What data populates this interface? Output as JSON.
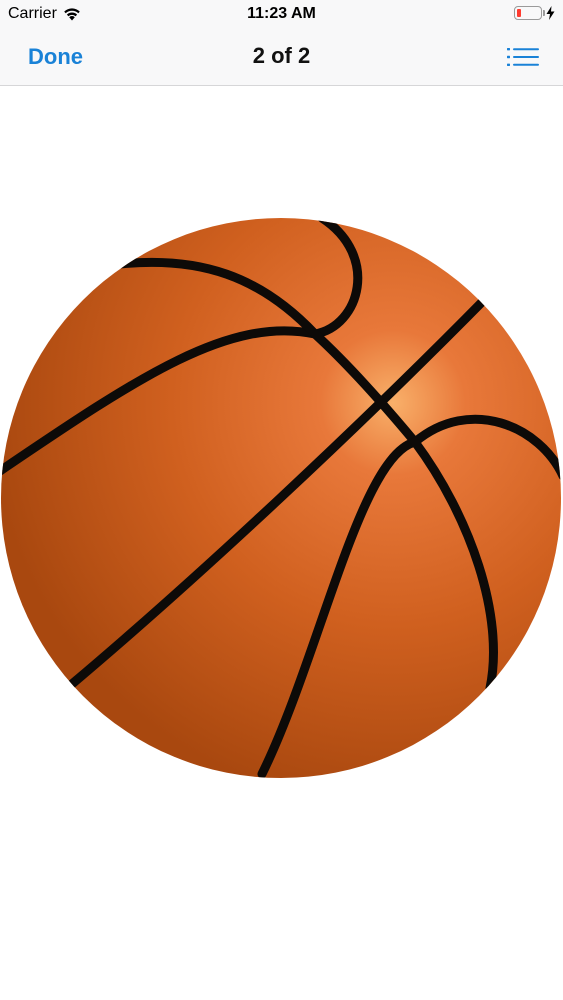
{
  "status_bar": {
    "carrier": "Carrier",
    "time": "11:23 AM",
    "battery_level": 0.2,
    "icons": [
      "wifi-icon",
      "battery-icon",
      "charging-bolt-icon"
    ]
  },
  "nav_bar": {
    "done_label": "Done",
    "title": "2 of 2",
    "list_icon": "list-icon"
  },
  "content": {
    "image_subject": "basketball-image"
  },
  "colors": {
    "accent": "#1a82d7",
    "ball_base": "#d8641f",
    "ball_highlight": "#f7a45a",
    "ball_shadow": "#9c4511",
    "seam": "#0d0a08",
    "battery_low": "#ff3b30"
  }
}
